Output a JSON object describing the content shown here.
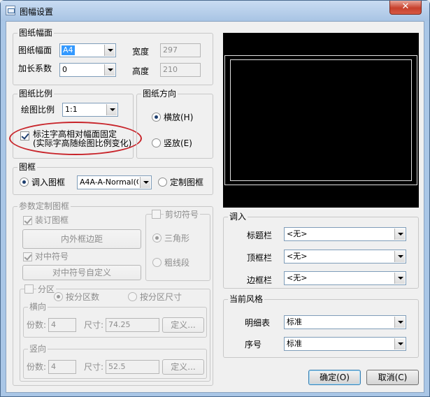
{
  "window": {
    "title": "图幅设置",
    "close_glyph": "✕"
  },
  "paper_size": {
    "legend": "图纸幅面",
    "size_label": "图纸幅面",
    "size_value": "A4",
    "width_label": "宽度",
    "width_value": "297",
    "extend_label": "加长系数",
    "extend_value": "0",
    "height_label": "高度",
    "height_value": "210"
  },
  "scale": {
    "legend": "图纸比例",
    "ratio_label": "绘图比例",
    "ratio_value": "1:1",
    "fixed_text_line1": "标注字高相对幅面固定",
    "fixed_text_line2": "(实际字高随绘图比例变化)"
  },
  "orientation": {
    "legend": "图纸方向",
    "landscape": "横放(H)",
    "portrait": "竖放(E)"
  },
  "frame": {
    "legend": "图框",
    "load_label": "调入图框",
    "load_value": "A4A-A-Normal(CH)",
    "custom_label": "定制图框"
  },
  "custom_params": {
    "legend": "参数定制图框",
    "install_frame": "装订图框",
    "margins_button": "内外框边距",
    "center_mark": "对中符号",
    "center_mark_button": "对中符号自定义",
    "cut_mark": {
      "legend": "剪切符号",
      "triangle": "三角形",
      "thick_line": "粗线段"
    },
    "partition": {
      "legend": "分区",
      "by_count": "按分区数",
      "by_size": "按分区尺寸",
      "horizontal": {
        "legend": "横向",
        "count_label": "份数:",
        "count_value": "4",
        "size_label": "尺寸:",
        "size_value": "74.25",
        "custom_button": "定义..."
      },
      "vertical": {
        "legend": "竖向",
        "count_label": "份数:",
        "count_value": "4",
        "size_label": "尺寸:",
        "size_value": "52.5",
        "custom_button": "定义..."
      }
    }
  },
  "import": {
    "legend": "调入",
    "title_bar_label": "标题栏",
    "title_bar_value": "<无>",
    "top_bar_label": "顶框栏",
    "top_bar_value": "<无>",
    "border_bar_label": "边框栏",
    "border_bar_value": "<无>"
  },
  "style": {
    "legend": "当前风格",
    "bom_label": "明细表",
    "bom_value": "标准",
    "seq_label": "序号",
    "seq_value": "标准"
  },
  "buttons": {
    "ok": "确定(O)",
    "cancel": "取消(C)"
  }
}
